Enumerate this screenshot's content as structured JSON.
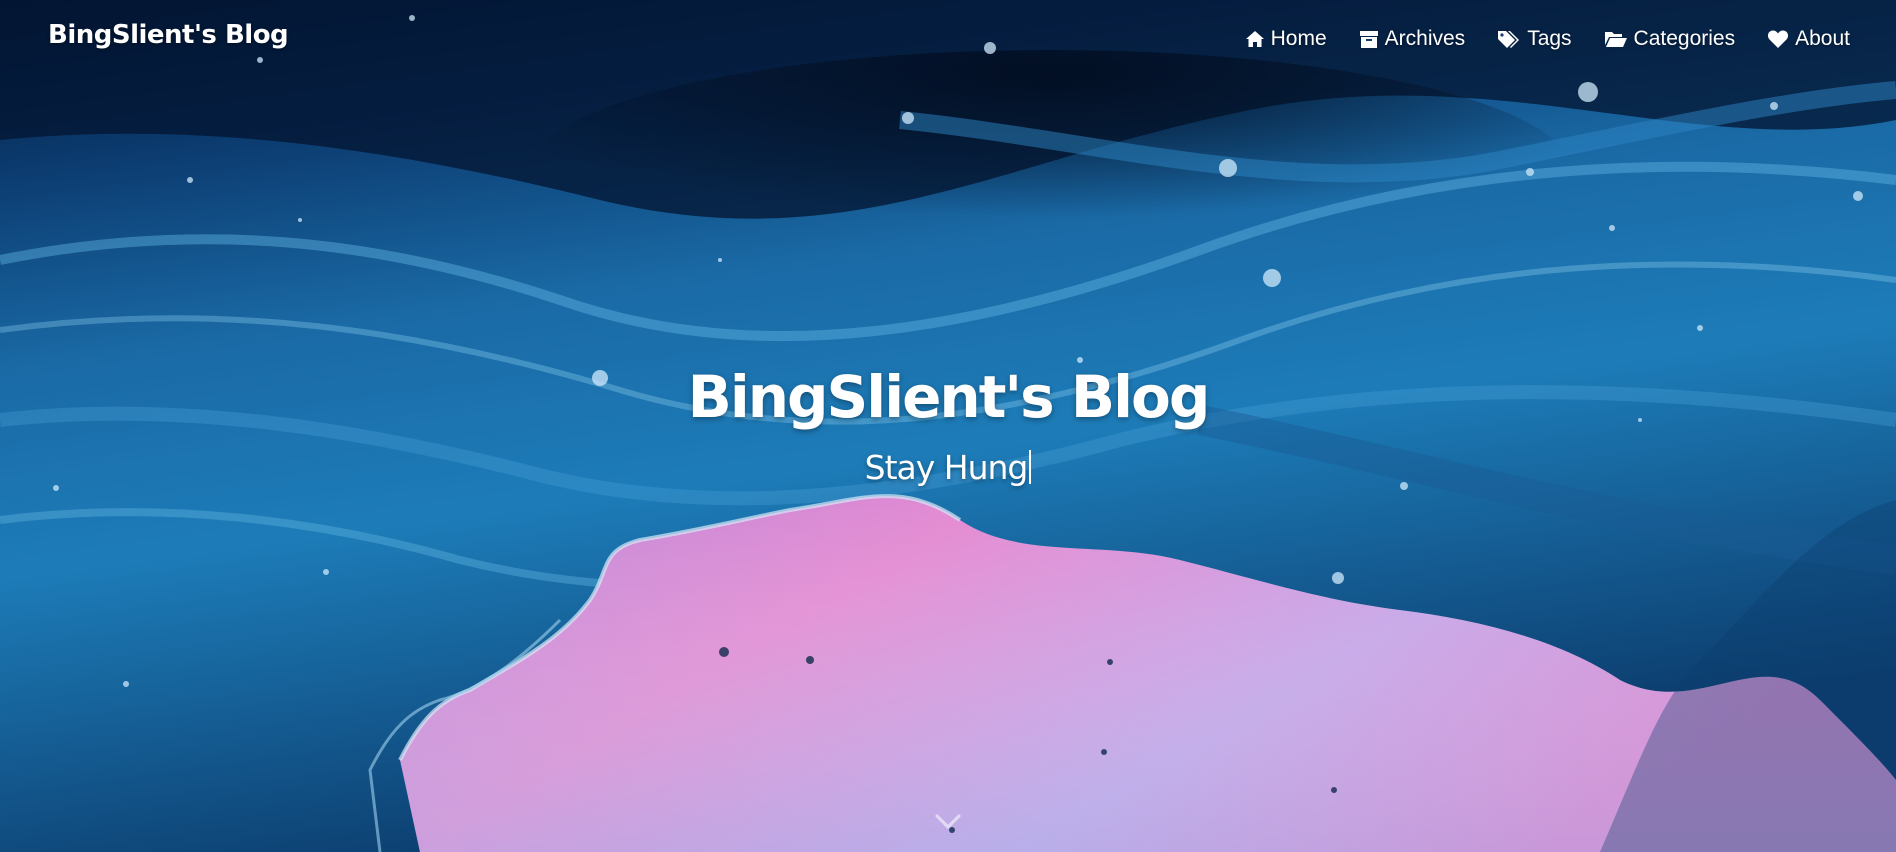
{
  "site": {
    "brand": "BingSlient's Blog"
  },
  "nav": {
    "items": [
      {
        "label": "Home",
        "icon": "home-icon"
      },
      {
        "label": "Archives",
        "icon": "archive-icon"
      },
      {
        "label": "Tags",
        "icon": "tags-icon"
      },
      {
        "label": "Categories",
        "icon": "folder-open-icon"
      },
      {
        "label": "About",
        "icon": "heart-icon"
      }
    ]
  },
  "hero": {
    "title": "BingSlient's Blog",
    "subtitle": "Stay Hung",
    "scroll_icon": "chevron-down-icon"
  },
  "colors": {
    "text": "#ffffff",
    "bg_deep_blue": "#0a2a52",
    "bg_mid_blue": "#1f78b4",
    "bg_light_blue": "#6fc0e8",
    "bg_pink": "#e48ad2",
    "bg_lavender": "#a8a6e6"
  }
}
